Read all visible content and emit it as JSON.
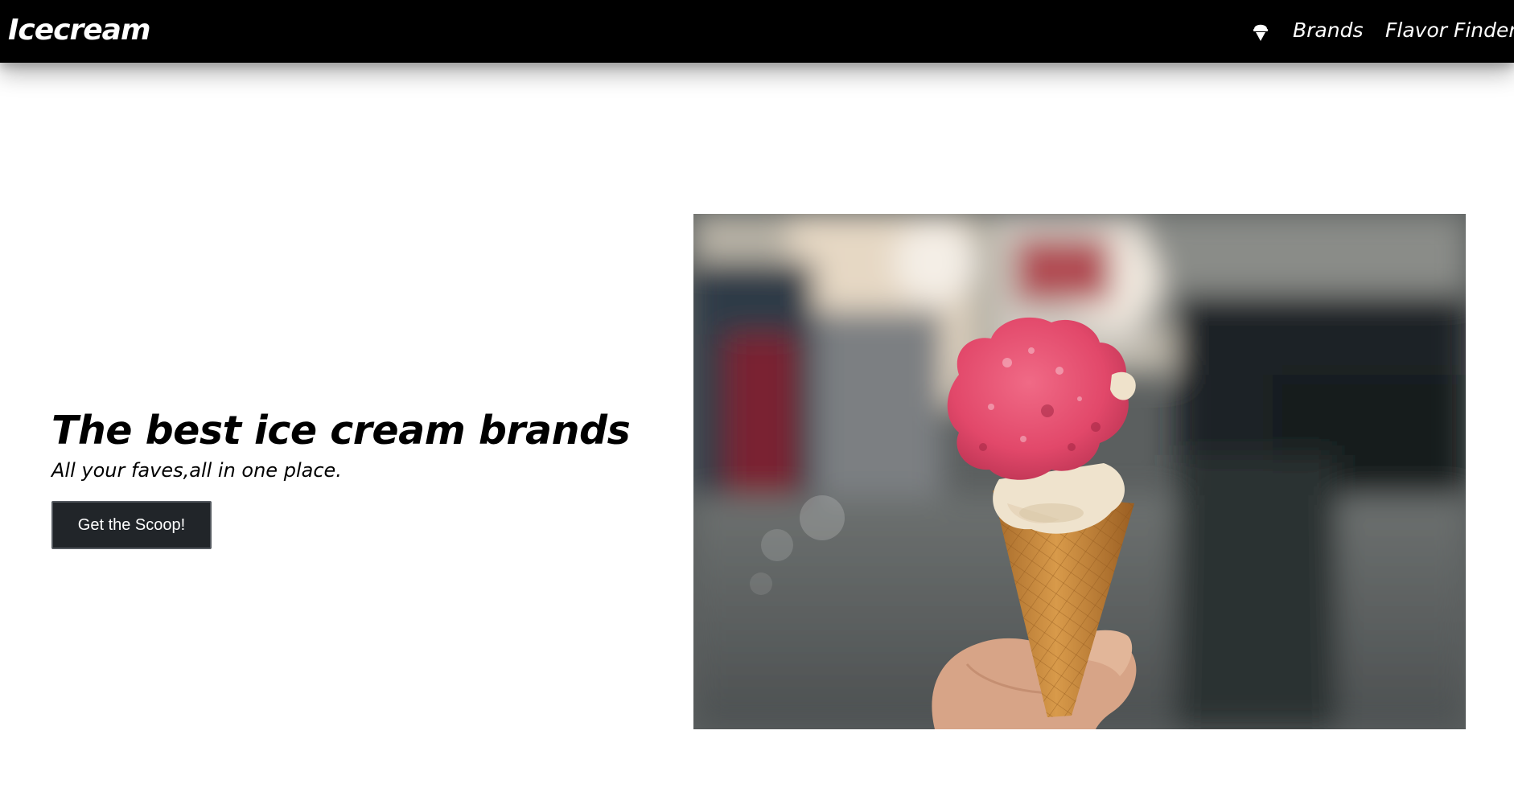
{
  "navbar": {
    "brand": "Icecream",
    "icon": "ice-cream-cone-icon",
    "links": [
      {
        "label": "Brands"
      },
      {
        "label": "Flavor Finder"
      }
    ]
  },
  "hero": {
    "title": "The best ice cream brands",
    "subtitle": "All your faves,all in one place.",
    "button_label": "Get the Scoop!"
  },
  "image": {
    "subject": "pink-ice-cream-cone-photo"
  },
  "colors": {
    "navbar_bg": "#000000",
    "nav_text": "#ffffff",
    "button_bg": "#212529",
    "ice_cream_pink": "#e94d6b",
    "cone": "#c8873a"
  }
}
